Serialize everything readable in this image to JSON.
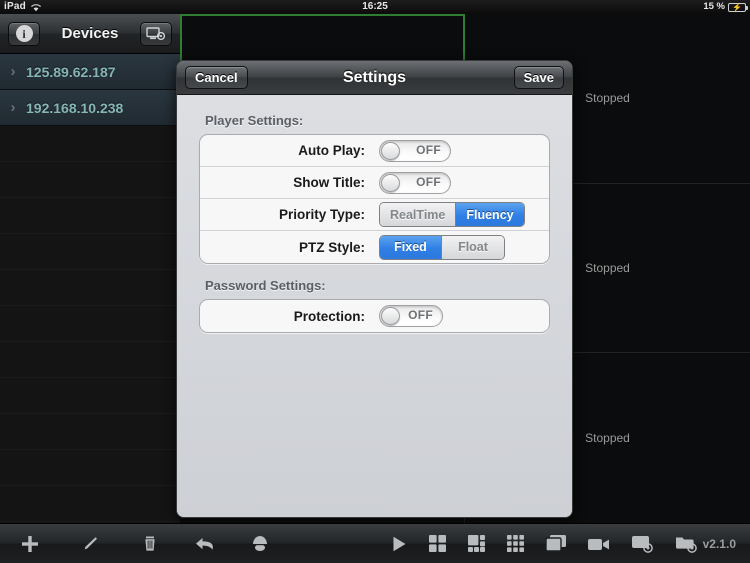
{
  "statusbar": {
    "device_label": "iPad",
    "wifi_icon": "wifi-icon",
    "time": "16:25",
    "battery_percent": "15 %",
    "battery_icon": "battery-charging-icon"
  },
  "sidebar": {
    "header": {
      "info_icon": "info-icon",
      "title": "Devices",
      "device_config_icon": "device-config-icon"
    },
    "devices": [
      {
        "ip": "125.89.62.187",
        "chevron": "chevron-right-icon"
      },
      {
        "ip": "192.168.10.238",
        "chevron": "chevron-right-icon"
      }
    ]
  },
  "video_grid": {
    "selected_border_color": "#2f7d32",
    "cells": [
      {
        "status": "",
        "selected": true
      },
      {
        "status": ""
      },
      {
        "status": "Stopped"
      },
      {
        "status": ""
      },
      {
        "status": "Stopped"
      },
      {
        "status": ""
      },
      {
        "status": "Stopped"
      }
    ],
    "right_column_status": [
      "Stopped",
      "Stopped",
      "Stopped"
    ]
  },
  "modal": {
    "cancel_label": "Cancel",
    "title": "Settings",
    "save_label": "Save",
    "groups": [
      {
        "title": "Player Settings:",
        "rows": [
          {
            "label": "Auto Play:",
            "type": "toggle",
            "value": "OFF"
          },
          {
            "label": "Show Title:",
            "type": "toggle",
            "value": "OFF"
          },
          {
            "label": "Priority Type:",
            "type": "segmented",
            "options": [
              "RealTime",
              "Fluency"
            ],
            "selected": "Fluency"
          },
          {
            "label": "PTZ Style:",
            "type": "segmented",
            "options": [
              "Fixed",
              "Float"
            ],
            "selected": "Fixed"
          }
        ]
      },
      {
        "title": "Password Settings:",
        "rows": [
          {
            "label": "Protection:",
            "type": "toggle",
            "value": "OFF"
          }
        ]
      }
    ],
    "accent_color": "#2f7fe5"
  },
  "toolbar_left": {
    "icons": [
      "add-icon",
      "edit-icon",
      "delete-icon"
    ]
  },
  "toolbar_right": {
    "icons": [
      "back-icon",
      "ptz-icon",
      "play-icon",
      "layout-4-icon",
      "layout-6-icon",
      "layout-9-icon",
      "layout-1-icon",
      "video-camera-icon",
      "playback-screen-icon",
      "playback-folder-icon"
    ],
    "version": "v2.1.0"
  }
}
